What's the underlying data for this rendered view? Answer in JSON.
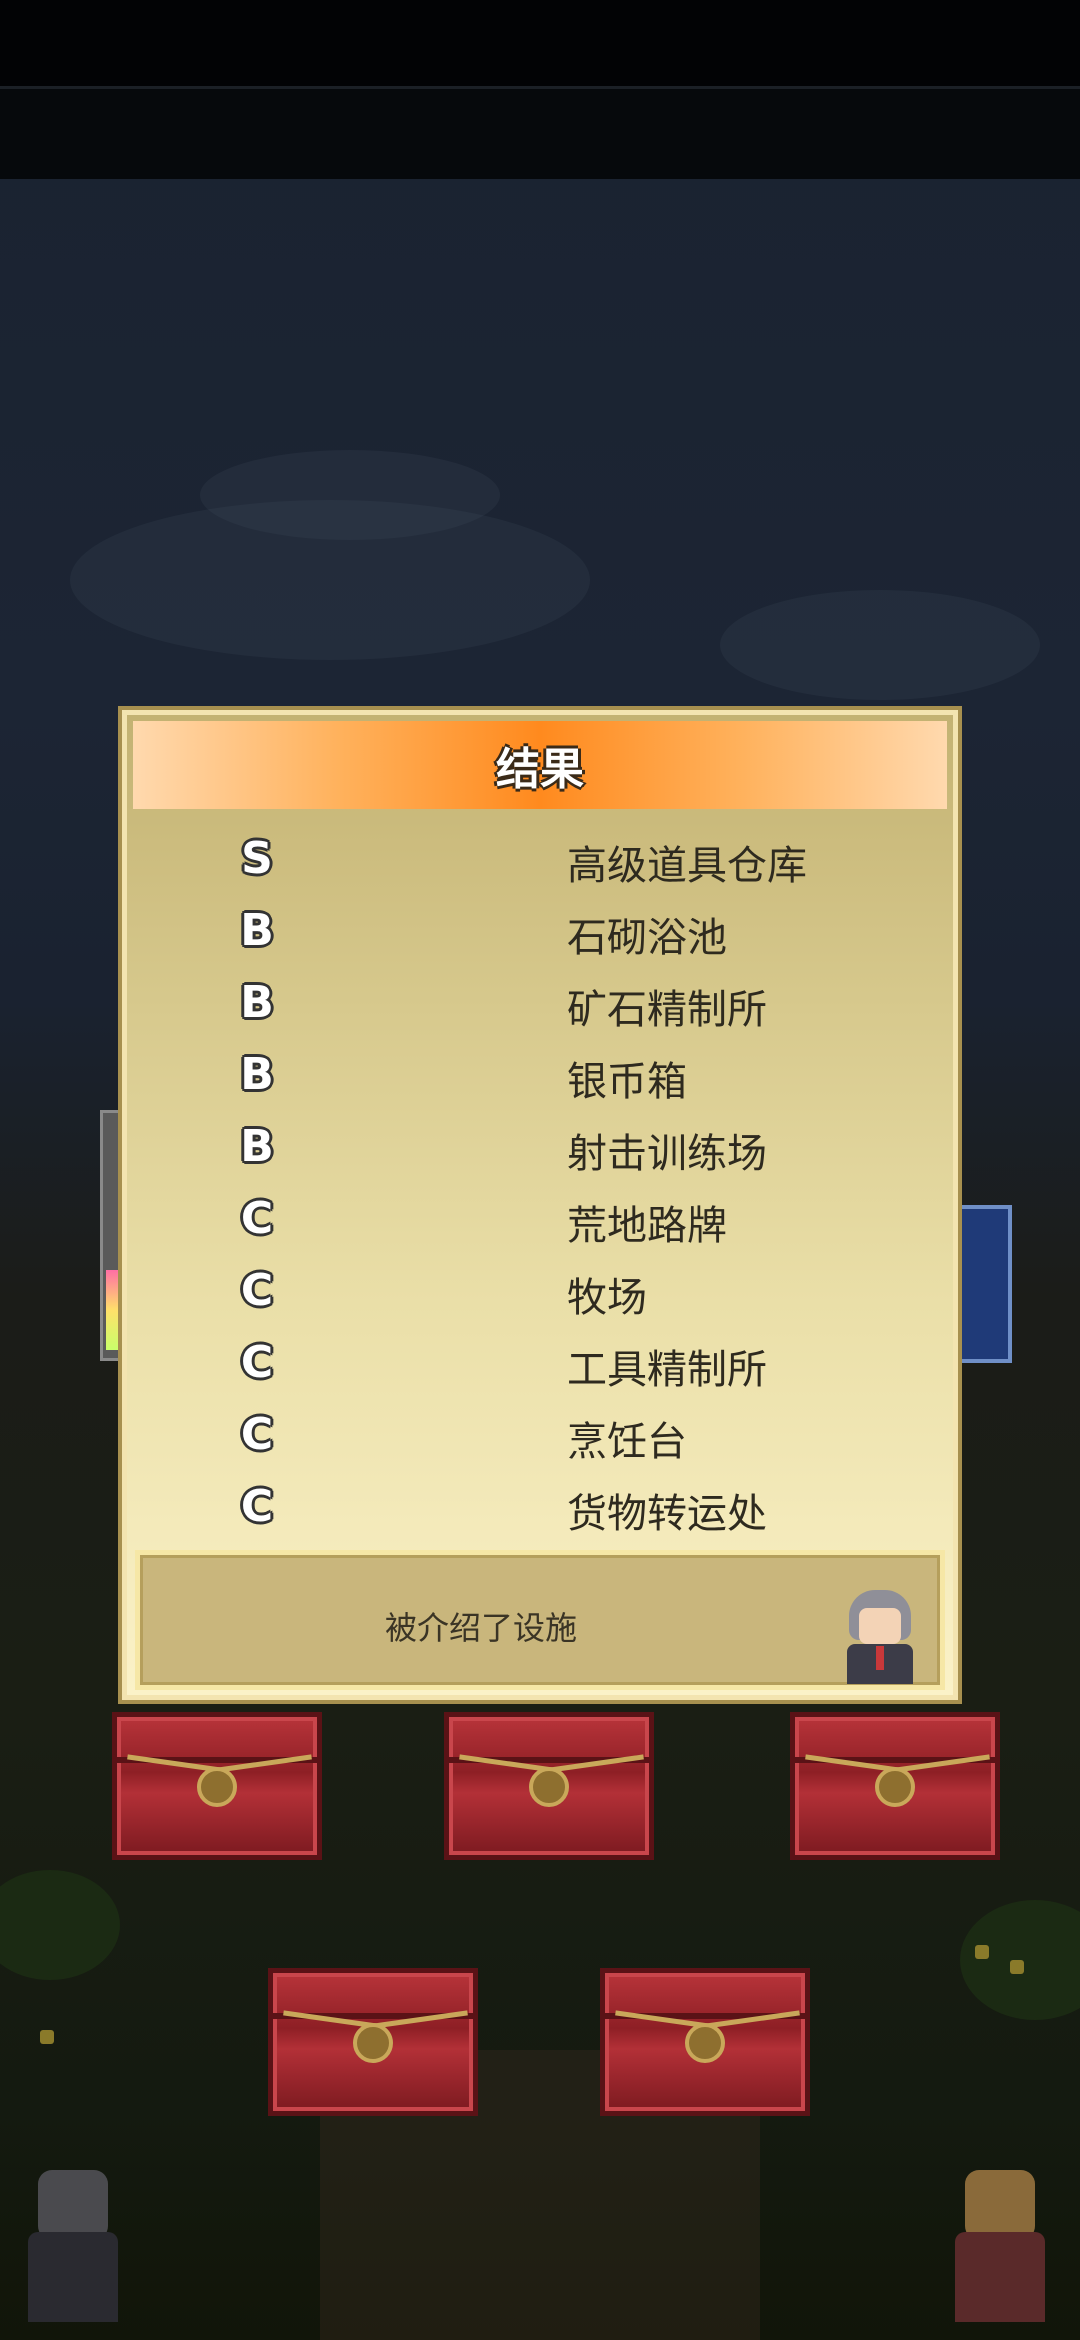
{
  "dialog": {
    "title": "结果",
    "results": [
      {
        "grade": "S",
        "facility": "高级道具仓库"
      },
      {
        "grade": "B",
        "facility": "石砌浴池"
      },
      {
        "grade": "B",
        "facility": "矿石精制所"
      },
      {
        "grade": "B",
        "facility": "银币箱"
      },
      {
        "grade": "B",
        "facility": "射击训练场"
      },
      {
        "grade": "C",
        "facility": "荒地路牌"
      },
      {
        "grade": "C",
        "facility": "牧场"
      },
      {
        "grade": "C",
        "facility": "工具精制所"
      },
      {
        "grade": "C",
        "facility": "烹饪台"
      },
      {
        "grade": "C",
        "facility": "货物转运处"
      }
    ],
    "message": "被介绍了设施"
  },
  "colors": {
    "header_orange": "#ff8a1e",
    "dialog_bg_top": "#c3b272",
    "dialog_bg_bottom": "#fbf2c8",
    "chest_red": "#b8343a"
  },
  "icons": {
    "advisor": "advisor-portrait-icon",
    "chest": "treasure-chest-icon"
  }
}
